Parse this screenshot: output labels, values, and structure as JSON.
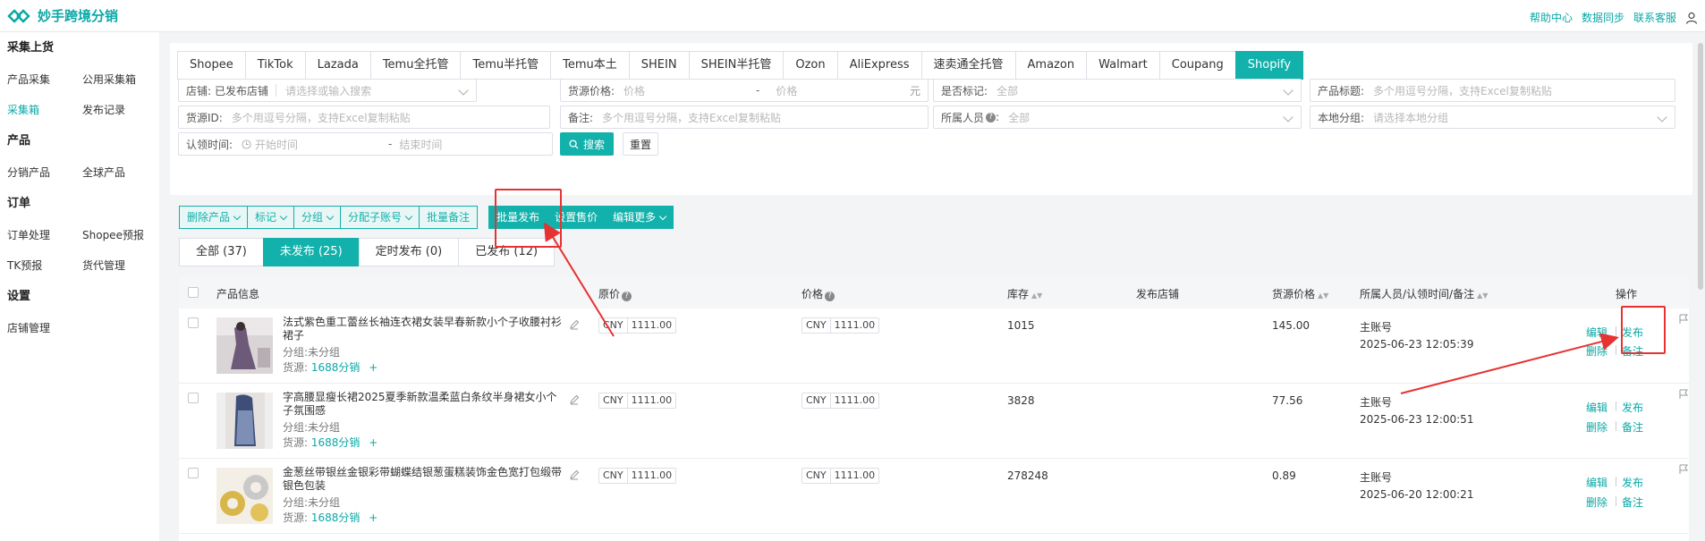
{
  "app": {
    "title": "妙手跨境分销"
  },
  "top_links": [
    "帮助中心",
    "数据同步",
    "联系客服"
  ],
  "sidebar": {
    "groups": [
      {
        "title": "采集上货",
        "rows": [
          [
            "产品采集",
            "公用采集箱"
          ],
          [
            "采集箱",
            "发布记录"
          ]
        ]
      },
      {
        "title": "产品",
        "rows": [
          [
            "分销产品",
            "全球产品"
          ]
        ]
      },
      {
        "title": "订单",
        "rows": [
          [
            "订单处理",
            "Shopee预报"
          ],
          [
            "TK预报",
            "货代管理"
          ]
        ]
      },
      {
        "title": "设置",
        "rows": [
          [
            "店铺管理"
          ]
        ]
      }
    ],
    "active": "采集箱"
  },
  "platform_tabs": [
    "Shopee",
    "TikTok",
    "Lazada",
    "Temu全托管",
    "Temu半托管",
    "Temu本土",
    "SHEIN",
    "SHEIN半托管",
    "Ozon",
    "AliExpress",
    "速卖通全托管",
    "Amazon",
    "Walmart",
    "Coupang",
    "Shopify"
  ],
  "platform_active": "Shopify",
  "filters": {
    "store_label": "店铺:",
    "store_value": "已发布店铺",
    "store_ph": "请选择或输入搜索",
    "src_price_label": "货源价格:",
    "src_price_ph1": "价格",
    "src_price_sep": "-",
    "src_price_ph2": "价格",
    "src_price_unit": "元",
    "marked_label": "是否标记:",
    "marked_value": "全部",
    "title_label": "产品标题:",
    "title_ph": "多个用逗号分隔，支持Excel复制粘贴",
    "srcid_label": "货源ID:",
    "srcid_ph": "多个用逗号分隔，支持Excel复制粘贴",
    "remark_label": "备注:",
    "remark_ph": "多个用逗号分隔，支持Excel复制粘贴",
    "owner_label": "所属人员",
    "owner_help": "?",
    "owner_colon": ":",
    "owner_value": "全部",
    "group_label": "本地分组:",
    "group_ph": "请选择本地分组",
    "claim_label": "认领时间:",
    "claim_ph1": "开始时间",
    "claim_sep": "-",
    "claim_ph2": "结束时间",
    "search_btn": "搜索",
    "reset_btn": "重置"
  },
  "actions": {
    "delete": "删除产品",
    "mark": "标记",
    "group": "分组",
    "assign": "分配子账号",
    "batch_remark": "批量备注",
    "batch_publish": "批量发布",
    "set_price": "设置售价",
    "edit_more": "编辑更多"
  },
  "status_tabs": [
    "全部 (37)",
    "未发布 (25)",
    "定时发布 (0)",
    "已发布 (12)"
  ],
  "status_active": "未发布 (25)",
  "table": {
    "headers": {
      "info": "产品信息",
      "orig": "原价",
      "price": "价格",
      "stock": "库存",
      "store": "发布店铺",
      "src_price": "货源价格",
      "owner": "所属人员/认领时间/备注",
      "ops": "操作"
    },
    "group_prefix": "分组:",
    "source_prefix": "货源:",
    "source_name": "1688分销",
    "add": "+",
    "currency": "CNY",
    "op_edit": "编辑",
    "op_publish": "发布",
    "op_delete": "删除",
    "op_remark": "备注",
    "rows": [
      {
        "title": "法式紫色重工蕾丝长袖连衣裙女装早春新款小个子收腰衬衫裙子",
        "group": "未分组",
        "orig": "1111.00",
        "price": "1111.00",
        "stock": "1015",
        "src_price": "145.00",
        "owner": "主账号",
        "time": "2025-06-23 12:05:39"
      },
      {
        "title": "字高腰显瘦长裙2025夏季新款温柔蓝白条纹半身裙女小个子氛围感",
        "group": "未分组",
        "orig": "1111.00",
        "price": "1111.00",
        "stock": "3828",
        "src_price": "77.56",
        "owner": "主账号",
        "time": "2025-06-23 12:00:51"
      },
      {
        "title": "金葱丝带银丝金银彩带蝴蝶结银葱蛋糕装饰金色宽打包缎带银色包装",
        "group": "未分组",
        "orig": "1111.00",
        "price": "1111.00",
        "stock": "278248",
        "src_price": "0.89",
        "owner": "主账号",
        "time": "2025-06-20 12:00:21"
      }
    ]
  },
  "colors": {
    "accent": "#12b1ab",
    "annotation": "#e63232"
  }
}
